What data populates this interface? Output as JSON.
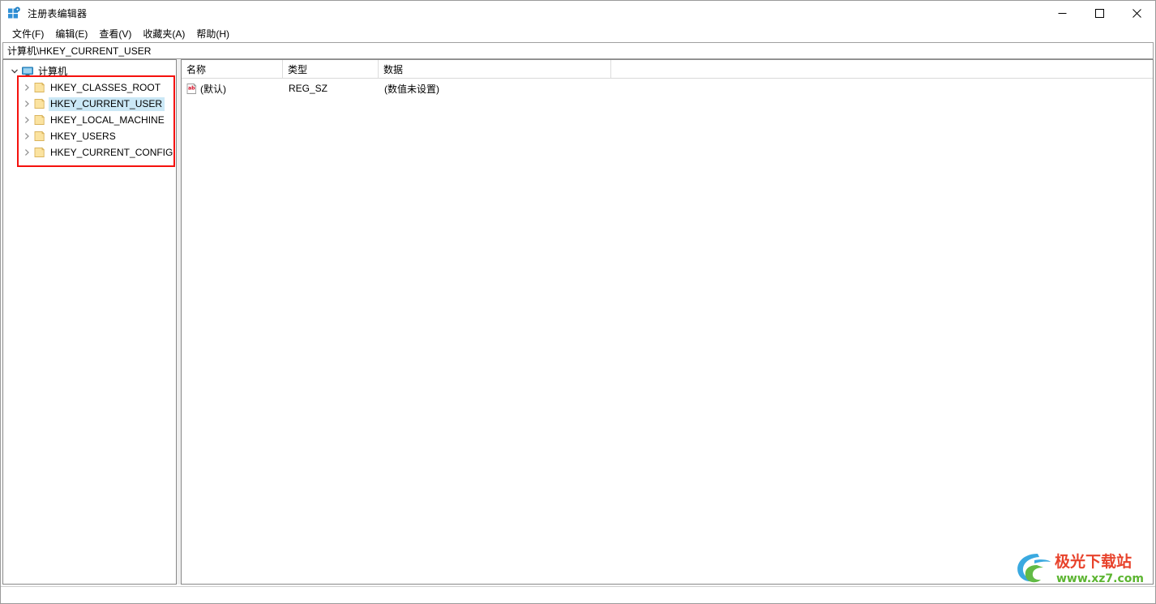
{
  "window": {
    "title": "注册表编辑器",
    "app_icon": "registry-editor-icon",
    "controls": {
      "minimize": "—",
      "maximize": "☐",
      "close": "✕"
    }
  },
  "menubar": {
    "items": [
      {
        "label": "文件(F)",
        "name": "menu-file"
      },
      {
        "label": "编辑(E)",
        "name": "menu-edit"
      },
      {
        "label": "查看(V)",
        "name": "menu-view"
      },
      {
        "label": "收藏夹(A)",
        "name": "menu-favorites"
      },
      {
        "label": "帮助(H)",
        "name": "menu-help"
      }
    ]
  },
  "address_bar": {
    "value": "计算机\\HKEY_CURRENT_USER",
    "placeholder": ""
  },
  "tree": {
    "root": {
      "label": "计算机",
      "expanded": true,
      "icon": "computer-monitor-icon"
    },
    "items": [
      {
        "label": "HKEY_CLASSES_ROOT",
        "selected": false,
        "expanded": false
      },
      {
        "label": "HKEY_CURRENT_USER",
        "selected": true,
        "expanded": false
      },
      {
        "label": "HKEY_LOCAL_MACHINE",
        "selected": false,
        "expanded": false
      },
      {
        "label": "HKEY_USERS",
        "selected": false,
        "expanded": false
      },
      {
        "label": "HKEY_CURRENT_CONFIG",
        "selected": false,
        "expanded": false
      }
    ]
  },
  "list": {
    "columns": [
      {
        "label": "名称",
        "name": "column-name"
      },
      {
        "label": "类型",
        "name": "column-type"
      },
      {
        "label": "数据",
        "name": "column-data"
      }
    ],
    "rows": [
      {
        "icon": "string-value-icon",
        "name": "(默认)",
        "type": "REG_SZ",
        "data": "(数值未设置)"
      }
    ]
  },
  "status_bar": {
    "text": ""
  },
  "annotation": {
    "color": "#f5110d",
    "shape": "rectangle"
  },
  "watermark": {
    "title": "极光下载站",
    "url": "www.xz7.com"
  },
  "colors": {
    "selection": "#cbe8f6",
    "folder": "#fbe3a0",
    "annotation_red": "#f5110d",
    "accent_blue": "#2196d8",
    "watermark_red": "#e8432c",
    "watermark_green": "#5cb531"
  }
}
